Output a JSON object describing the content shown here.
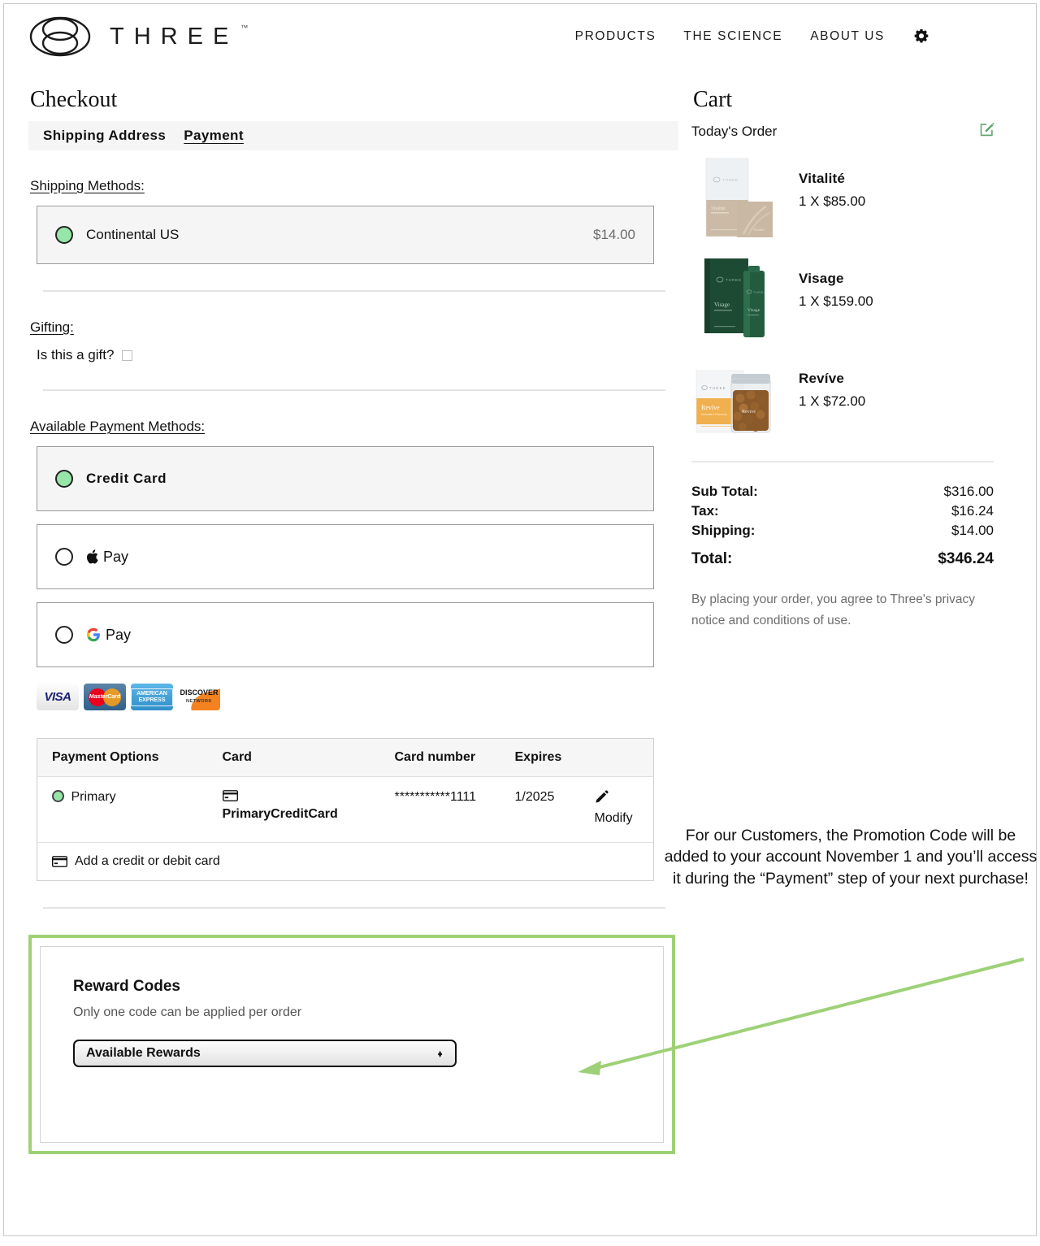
{
  "header": {
    "brand": "THREE",
    "trademark": "™",
    "nav": [
      {
        "label": "PRODUCTS"
      },
      {
        "label": "THE SCIENCE"
      },
      {
        "label": "ABOUT US"
      }
    ],
    "settings_icon": "gear-icon"
  },
  "checkout": {
    "title": "Checkout",
    "tabs": [
      {
        "label": "Shipping Address",
        "active": false
      },
      {
        "label": "Payment",
        "active": true
      }
    ],
    "shipping_methods_label": "Shipping Methods:",
    "shipping_methods": [
      {
        "label": "Continental US",
        "price": "$14.00",
        "selected": true
      }
    ],
    "gifting_label": "Gifting:",
    "gift_question": "Is this a gift?",
    "gift_checked": false,
    "payment_methods_label": "Available Payment Methods:",
    "payment_methods": [
      {
        "label": "Credit Card",
        "selected": true
      },
      {
        "label": "Pay",
        "brand": "apple",
        "selected": false
      },
      {
        "label": "Pay",
        "brand": "google",
        "selected": false
      }
    ],
    "accepted_cards": [
      {
        "name": "VISA"
      },
      {
        "name": "MasterCard"
      },
      {
        "name": "AMERICAN EXPRESS"
      },
      {
        "name": "DISCOVER NETWORK"
      }
    ],
    "card_table": {
      "headers": [
        "Payment Options",
        "Card",
        "Card number",
        "Expires",
        ""
      ],
      "rows": [
        {
          "option": "Primary",
          "selected": true,
          "card": "PrimaryCreditCard",
          "number": "***********1111",
          "expires": "1/2025",
          "action": "Modify"
        }
      ],
      "add_card_label": "Add a credit or debit card"
    },
    "rewards": {
      "title": "Reward Codes",
      "subtitle": "Only one code can be applied per order",
      "select_value": "Available Rewards"
    }
  },
  "cart": {
    "title": "Cart",
    "subtitle": "Today's Order",
    "edit_icon": "edit-square-icon",
    "items": [
      {
        "name": "Vitalité",
        "qty_price": "1 X $85.00"
      },
      {
        "name": "Visage",
        "qty_price": "1 X $159.00"
      },
      {
        "name": "Revíve",
        "qty_price": "1 X $72.00"
      }
    ],
    "totals": [
      {
        "label": "Sub Total:",
        "value": "$316.00"
      },
      {
        "label": "Tax:",
        "value": "$16.24"
      },
      {
        "label": "Shipping:",
        "value": "$14.00"
      }
    ],
    "grand_total": {
      "label": "Total:",
      "value": "$346.24"
    },
    "legal": "By placing your order, you agree to Three's privacy notice and conditions of use."
  },
  "annotation": {
    "text": "For our Customers, the Promotion Code will be added to your account November 1 and you’ll access it during the “Payment” step of your next purchase!",
    "color": "#9ed177"
  },
  "colors": {
    "accent_green": "#95e6a8",
    "annotation_green": "#9ed177",
    "edit_green": "#5aa469",
    "panel_gray": "#f5f5f5",
    "border_gray": "#9a9a9a"
  }
}
